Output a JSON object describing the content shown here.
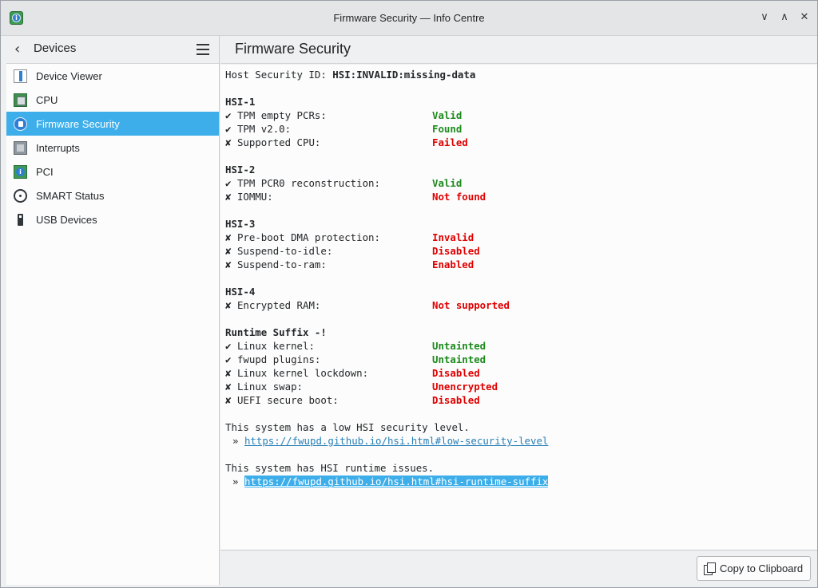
{
  "window": {
    "title": "Firmware Security — Info Centre",
    "minimize_glyph": "∨",
    "maximize_glyph": "∧",
    "close_glyph": "✕"
  },
  "sidebar": {
    "title": "Devices",
    "back_glyph": "‹",
    "items": [
      {
        "label": "Device Viewer",
        "icon": "device-viewer-icon"
      },
      {
        "label": "CPU",
        "icon": "cpu-icon"
      },
      {
        "label": "Firmware Security",
        "icon": "firmware-security-icon",
        "active": true
      },
      {
        "label": "Interrupts",
        "icon": "interrupts-icon"
      },
      {
        "label": "PCI",
        "icon": "pci-icon"
      },
      {
        "label": "SMART Status",
        "icon": "smart-status-icon"
      },
      {
        "label": "USB Devices",
        "icon": "usb-devices-icon"
      }
    ]
  },
  "main": {
    "title": "Firmware Security",
    "host_label": "Host Security ID: ",
    "host_value": "HSI:INVALID:missing-data",
    "sections": [
      {
        "heading": "HSI-1",
        "rows": [
          {
            "mark": "✔",
            "label": "TPM empty PCRs:",
            "value": "Valid",
            "state": "ok"
          },
          {
            "mark": "✔",
            "label": "TPM v2.0:",
            "value": "Found",
            "state": "ok"
          },
          {
            "mark": "✘",
            "label": "Supported CPU:",
            "value": "Failed",
            "state": "bad"
          }
        ]
      },
      {
        "heading": "HSI-2",
        "rows": [
          {
            "mark": "✔",
            "label": "TPM PCR0 reconstruction:",
            "value": "Valid",
            "state": "ok"
          },
          {
            "mark": "✘",
            "label": "IOMMU:",
            "value": "Not found",
            "state": "bad"
          }
        ]
      },
      {
        "heading": "HSI-3",
        "rows": [
          {
            "mark": "✘",
            "label": "Pre-boot DMA protection:",
            "value": "Invalid",
            "state": "bad"
          },
          {
            "mark": "✘",
            "label": "Suspend-to-idle:",
            "value": "Disabled",
            "state": "bad"
          },
          {
            "mark": "✘",
            "label": "Suspend-to-ram:",
            "value": "Enabled",
            "state": "bad"
          }
        ]
      },
      {
        "heading": "HSI-4",
        "rows": [
          {
            "mark": "✘",
            "label": "Encrypted RAM:",
            "value": "Not supported",
            "state": "bad"
          }
        ]
      },
      {
        "heading": "Runtime Suffix -!",
        "rows": [
          {
            "mark": "✔",
            "label": "Linux kernel:",
            "value": "Untainted",
            "state": "ok"
          },
          {
            "mark": "✔",
            "label": "fwupd plugins:",
            "value": "Untainted",
            "state": "ok"
          },
          {
            "mark": "✘",
            "label": "Linux kernel lockdown:",
            "value": "Disabled",
            "state": "bad"
          },
          {
            "mark": "✘",
            "label": "Linux swap:",
            "value": "Unencrypted",
            "state": "bad"
          },
          {
            "mark": "✘",
            "label": "UEFI secure boot:",
            "value": "Disabled",
            "state": "bad"
          }
        ]
      }
    ],
    "notes": [
      {
        "text": "This system has a low HSI security level.",
        "link": "https://fwupd.github.io/hsi.html#low-security-level",
        "selected": false
      },
      {
        "text": "This system has HSI runtime issues.",
        "link": "https://fwupd.github.io/hsi.html#hsi-runtime-suffix",
        "selected": true
      }
    ],
    "link_prefix": "»"
  },
  "footer": {
    "copy_label": "Copy to Clipboard"
  },
  "colors": {
    "accent": "#3daee9",
    "ok": "#1d8a1d",
    "bad": "#e00000",
    "link": "#2980b9"
  }
}
